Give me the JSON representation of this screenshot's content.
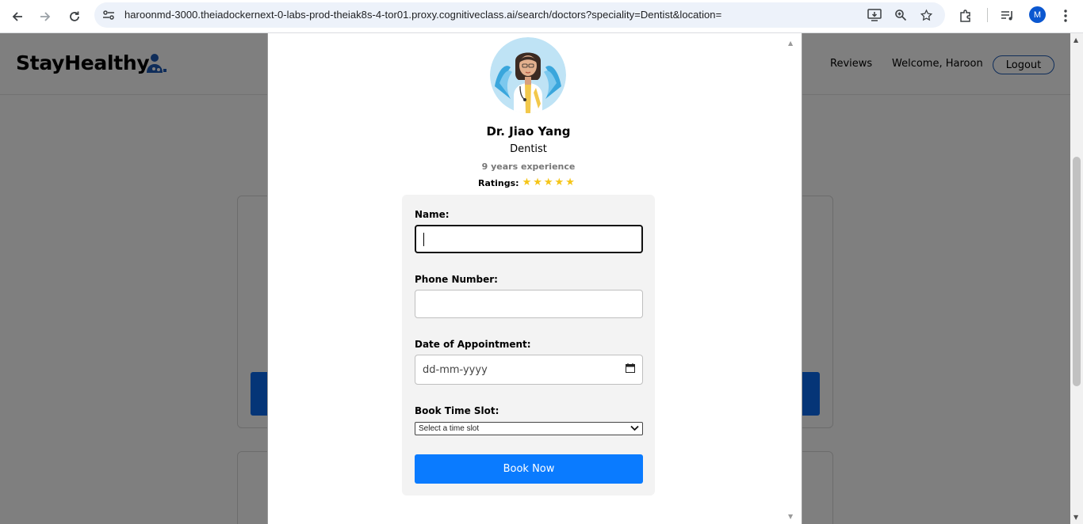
{
  "browser": {
    "url": "haroonmd-3000.theiadockernext-0-labs-prod-theiak8s-4-tor01.proxy.cognitiveclass.ai/search/doctors?speciality=Dentist&location=",
    "profile_initial": "M"
  },
  "site": {
    "logo_text": "StayHealthy",
    "nav": {
      "reviews": "Reviews",
      "welcome": "Welcome, Haroon",
      "logout": "Logout"
    }
  },
  "doctor": {
    "name": "Dr. Jiao Yang",
    "speciality": "Dentist",
    "experience": "9 years experience",
    "ratings_label": "Ratings:",
    "rating_stars": 5
  },
  "form": {
    "name_label": "Name:",
    "name_value": "",
    "phone_label": "Phone Number:",
    "phone_value": "",
    "date_label": "Date of Appointment:",
    "date_placeholder": "dd-mm-yyyy",
    "slot_label": "Book Time Slot:",
    "slot_selected": "Select a time slot",
    "submit_label": "Book Now"
  },
  "colors": {
    "primary": "#0a7bff",
    "star": "#f5c518",
    "logo_icon": "#1e5bb5"
  }
}
